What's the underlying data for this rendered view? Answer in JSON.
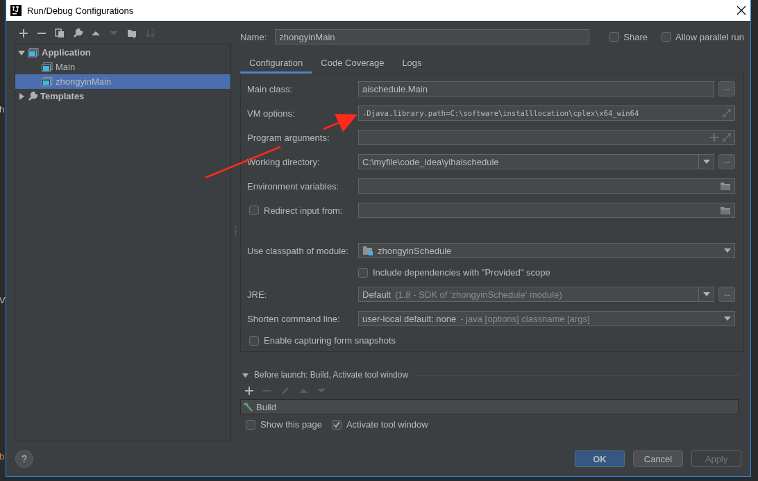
{
  "window": {
    "title": "Run/Debug Configurations"
  },
  "background_fragments": [
    "h",
    "V",
    "b"
  ],
  "toolbar": [
    {
      "kind": "add",
      "disabled": false
    },
    {
      "kind": "remove",
      "disabled": false
    },
    {
      "kind": "copy",
      "disabled": false
    },
    {
      "kind": "wrench",
      "disabled": false
    },
    {
      "kind": "up",
      "disabled": false
    },
    {
      "kind": "down",
      "disabled": true
    },
    {
      "kind": "folder",
      "disabled": false
    },
    {
      "kind": "sort",
      "disabled": true
    }
  ],
  "tree": [
    {
      "label": "Application",
      "kind": "application",
      "expanded": true,
      "selected": false,
      "children": [
        {
          "label": "Main",
          "kind": "config",
          "selected": false
        },
        {
          "label": "zhongyinMain",
          "kind": "config",
          "selected": true
        }
      ]
    },
    {
      "label": "Templates",
      "kind": "templates",
      "expanded": false,
      "selected": false
    }
  ],
  "name": {
    "label": "Name:",
    "value": "zhongyinMain"
  },
  "options": [
    {
      "label": "Share",
      "checked": false
    },
    {
      "label": "Allow parallel run",
      "checked": false
    }
  ],
  "tabs": [
    {
      "label": "Configuration",
      "selected": true
    },
    {
      "label": "Code Coverage",
      "selected": false
    },
    {
      "label": "Logs",
      "selected": false
    }
  ],
  "form": {
    "rows": [
      {
        "kind": "text-browse",
        "label": "Main class:",
        "value": "aischedule.Main",
        "browse": "..."
      },
      {
        "kind": "expand",
        "label": "VM options:",
        "value": "-Djava.library.path=C:\\software\\installlocation\\cplex\\x64_win64"
      },
      {
        "kind": "expand-add",
        "label": "Program arguments:"
      },
      {
        "kind": "combo-browse",
        "label": "Working directory:",
        "value": "C:\\myfile\\code_idea\\yihaischedule",
        "browse": "..."
      },
      {
        "kind": "folder",
        "label": "Environment variables:"
      },
      {
        "kind": "check-folder",
        "label": "Redirect input from:",
        "checked": false
      },
      {
        "kind": "module",
        "label": "Use classpath of module:",
        "value": "zhongyinSchedule"
      },
      {
        "kind": "checkbox",
        "label": "Include dependencies with \"Provided\" scope",
        "checked": false
      },
      {
        "kind": "combo-browse",
        "label": "JRE:",
        "value": "Default",
        "detail": "(1.8 - SDK of 'zhongyinSchedule' module)",
        "browse": "..."
      },
      {
        "kind": "combo",
        "label": "Shorten command line:",
        "value": "user-local default: none",
        "detail": "- java [options] classname [args]"
      },
      {
        "kind": "checkbox-wide",
        "label": "Enable capturing form snapshots",
        "checked": false
      }
    ]
  },
  "before_launch": {
    "title": "Before launch: Build, Activate tool window",
    "expanded": true,
    "toolbar": [
      {
        "kind": "add",
        "disabled": false
      },
      {
        "kind": "remove",
        "disabled": true
      },
      {
        "kind": "edit",
        "disabled": true
      },
      {
        "kind": "up",
        "disabled": true
      },
      {
        "kind": "down",
        "disabled": true
      }
    ],
    "tasks": [
      {
        "label": "Build"
      }
    ],
    "options": [
      {
        "label": "Show this page",
        "checked": false
      },
      {
        "label": "Activate tool window",
        "checked": true
      }
    ]
  },
  "help": "?",
  "buttons": [
    {
      "label": "OK",
      "kind": "default"
    },
    {
      "label": "Cancel",
      "kind": "normal"
    },
    {
      "label": "Apply",
      "kind": "disabled"
    }
  ]
}
